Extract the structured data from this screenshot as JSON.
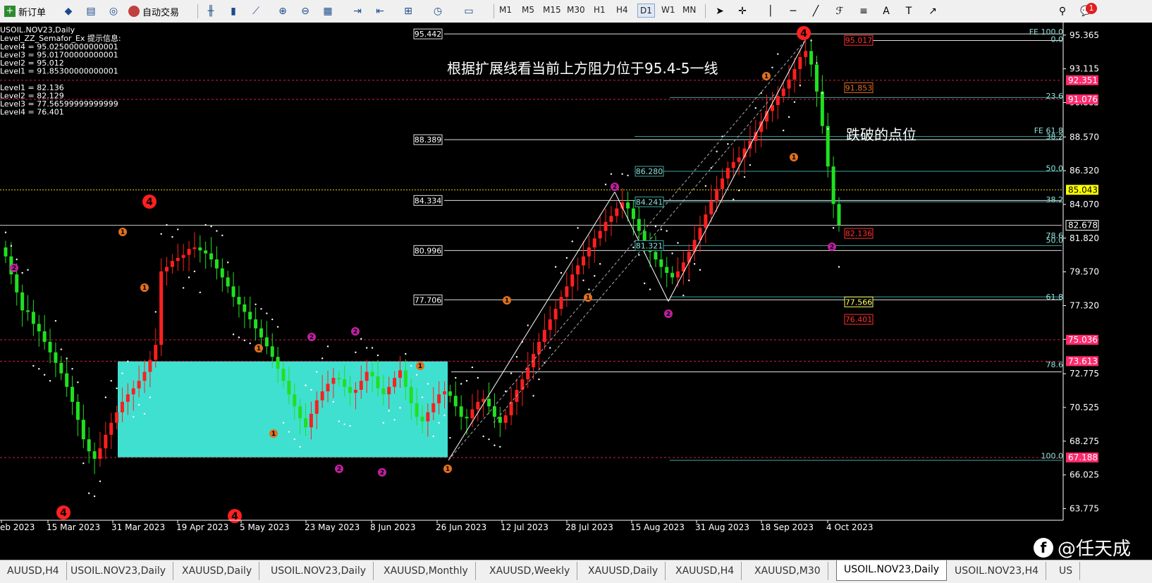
{
  "toolbar": {
    "new_order": "新订单",
    "auto_trade": "自动交易",
    "timeframes": [
      "M1",
      "M5",
      "M15",
      "M30",
      "H1",
      "H4",
      "D1",
      "W1",
      "MN"
    ],
    "active_timeframe": "D1",
    "notification_count": "1"
  },
  "chart_info": {
    "symbol_line": "USOIL.NOV23,Daily",
    "indicator_title": "Level_ZZ_Semafor_Ex 提示信息:",
    "levels_upper": [
      "Level4 = 95.02500000000001",
      "Level3 = 95.01700000000001",
      "Level2 = 95.012",
      "Level1 = 91.85300000000001"
    ],
    "levels_lower": [
      "Level1 = 82.136",
      "Level2 = 82.129",
      "Level3 = 77.56599999999999",
      "Level4 = 76.401"
    ]
  },
  "annotations": {
    "resistance_note": "根据扩展线看当前上方阻力位于95.4-5一线",
    "break_note": "跌破的点位"
  },
  "price_axis": {
    "ticks": [
      "95.365",
      "93.115",
      "90.865",
      "88.570",
      "86.320",
      "84.070",
      "81.820",
      "79.570",
      "77.320",
      "75.070",
      "72.775",
      "70.525",
      "68.275",
      "66.025",
      "63.775"
    ],
    "tags": [
      {
        "text": "92.351",
        "color": "#ff2a6d"
      },
      {
        "text": "91.076",
        "color": "#ff2a6d"
      },
      {
        "text": "85.043",
        "color": "#ffff00"
      },
      {
        "text": "82.678",
        "color": "#000000"
      },
      {
        "text": "75.036",
        "color": "#ff2a6d"
      },
      {
        "text": "73.613",
        "color": "#ff2a6d"
      },
      {
        "text": "67.188",
        "color": "#ff2a6d"
      }
    ]
  },
  "fib_labels": {
    "right": [
      "FE 100.0",
      "0.0",
      "23.6",
      "FE 61.8",
      "38.2",
      "50.0",
      "38.2",
      "78.6",
      "50.0",
      "61.8",
      "78.6",
      "100.0"
    ],
    "left_boxes": [
      "95.442",
      "88.389",
      "84.334",
      "80.996",
      "77.706"
    ],
    "mid_boxes": [
      "86.280",
      "84.241",
      "81.321"
    ],
    "semafor_labels": [
      {
        "text": "95.017",
        "color": "#ff3030"
      },
      {
        "text": "91.853",
        "color": "#e07020"
      },
      {
        "text": "82.136",
        "color": "#ff3030"
      },
      {
        "text": "77.566",
        "color": "#ffff60"
      },
      {
        "text": "76.401",
        "color": "#ff3030"
      }
    ]
  },
  "time_axis": [
    "eb 2023",
    "15 Mar 2023",
    "31 Mar 2023",
    "19 Apr 2023",
    "5 May 2023",
    "23 May 2023",
    "8 Jun 2023",
    "26 Jun 2023",
    "12 Jul 2023",
    "28 Jul 2023",
    "15 Aug 2023",
    "31 Aug 2023",
    "18 Sep 2023",
    "4 Oct 2023"
  ],
  "tabs": [
    "AUUSD,H4",
    "USOIL.NOV23,Daily",
    "XAUUSD,Daily",
    "USOIL.NOV23,Daily",
    "XAUUSD,Monthly",
    "XAUUSD,Weekly",
    "XAUUSD,Daily",
    "XAUUSD,H4",
    "XAUUSD,M30",
    "USOIL.NOV23,Daily",
    "USOIL.NOV23,H4",
    "US"
  ],
  "active_tab_index": 9,
  "watermark": "@任天成",
  "chart_data": {
    "type": "candlestick",
    "symbol": "USOIL.NOV23",
    "timeframe": "Daily",
    "y_range": [
      63.0,
      96.2
    ],
    "colors": {
      "up": "#ff1f1f",
      "down": "#20e020",
      "background": "#000000",
      "zone": "#40e0d0"
    },
    "consolidation_zone": {
      "from": "30 Mar 2023",
      "to": "26 Jun 2023",
      "low": 67.2,
      "high": 73.6
    },
    "closes": [
      80.6,
      79.4,
      78.2,
      77.0,
      76.9,
      76.1,
      75.6,
      74.9,
      74.2,
      73.5,
      72.8,
      71.9,
      70.9,
      69.7,
      68.4,
      67.6,
      67.1,
      67.8,
      68.7,
      69.5,
      70.2,
      70.9,
      71.4,
      71.8,
      72.3,
      72.9,
      73.7,
      74.7,
      79.6,
      79.9,
      80.3,
      80.5,
      80.7,
      81.1,
      81.2,
      81.0,
      80.8,
      80.4,
      79.8,
      79.2,
      78.6,
      77.9,
      77.4,
      76.9,
      76.4,
      75.8,
      75.2,
      74.6,
      73.9,
      73.1,
      72.3,
      71.4,
      70.6,
      69.8,
      69.2,
      70.1,
      71.0,
      71.6,
      72.1,
      72.5,
      72.4,
      71.9,
      71.5,
      71.7,
      72.3,
      72.9,
      72.6,
      71.8,
      71.4,
      71.9,
      72.5,
      73.0,
      71.9,
      70.8,
      69.9,
      69.6,
      70.2,
      70.8,
      71.4,
      71.6,
      71.3,
      70.6,
      69.9,
      69.8,
      70.4,
      70.9,
      71.1,
      70.6,
      69.9,
      69.5,
      70.0,
      70.9,
      71.7,
      72.4,
      73.2,
      74.1,
      74.9,
      75.7,
      76.4,
      77.1,
      77.9,
      78.6,
      79.4,
      80.0,
      80.6,
      81.2,
      81.8,
      82.3,
      82.9,
      83.3,
      83.8,
      84.2,
      83.8,
      83.1,
      82.3,
      81.6,
      80.9,
      80.4,
      79.9,
      79.5,
      79.2,
      79.6,
      80.2,
      80.9,
      81.7,
      82.5,
      83.4,
      84.3,
      85.1,
      85.8,
      86.5,
      86.9,
      87.2,
      87.8,
      88.3,
      88.9,
      89.6,
      90.3,
      90.7,
      91.3,
      91.8,
      92.4,
      93.1,
      93.9,
      94.3,
      93.4,
      91.6,
      89.3,
      86.6,
      84.1,
      82.7
    ]
  }
}
